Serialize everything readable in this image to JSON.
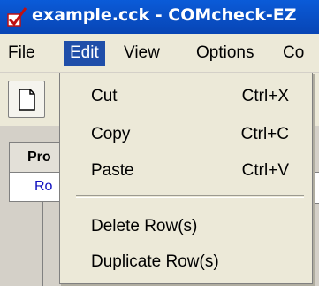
{
  "window": {
    "title": "example.cck - COMcheck-EZ"
  },
  "menubar": {
    "items": [
      {
        "label": "File"
      },
      {
        "label": "Edit"
      },
      {
        "label": "View"
      },
      {
        "label": "Options"
      },
      {
        "label": "Co"
      }
    ]
  },
  "edit_menu": {
    "items": [
      {
        "label": "Cut",
        "shortcut": "Ctrl+X"
      },
      {
        "label": "Copy",
        "shortcut": "Ctrl+C"
      },
      {
        "label": "Paste",
        "shortcut": "Ctrl+V"
      },
      {
        "label": "Delete Row(s)",
        "shortcut": ""
      },
      {
        "label": "Duplicate Row(s)",
        "shortcut": ""
      }
    ]
  },
  "workspace": {
    "tab_label": "Pro",
    "row_label": "Ro"
  },
  "colors": {
    "titlebar": "#0a5bd8",
    "menu_highlight": "#1f4ea9",
    "menu_bg": "#ece9d8"
  },
  "icons": [
    "app-checkmark-icon",
    "new-document-icon"
  ]
}
